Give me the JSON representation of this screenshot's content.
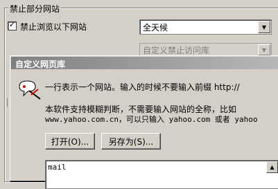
{
  "background_window": {
    "group_title": "禁止部分网站",
    "checkbox": {
      "label": "禁止浏览以下网站",
      "checked": true,
      "mark": "✓"
    },
    "schedule_combo": {
      "value": "全天候",
      "arrow": "▼"
    },
    "library_combo": {
      "value": "自定义禁止访问库",
      "arrow": "▼",
      "disabled": true
    }
  },
  "dialog": {
    "title": "自定义网页库",
    "icon": "info-balloon-icon",
    "line1": "一行表示一个网站。输入的时候不要输入前缀 http://",
    "line2": "本软件支持模糊判断，不需要输入网站的全称，比如",
    "line3": "www.yahoo.com.cn，可以只输入 yahoo.com 或者 yahoo",
    "open_button": "打开(O)...",
    "saveas_button": "另存为(S)...",
    "list": {
      "items": [
        "mail"
      ],
      "scroll_up": "▲"
    }
  },
  "colors": {
    "face": "#d4d0c8",
    "inactive_title_start": "#808080",
    "inactive_title_end": "#b8b8b8"
  }
}
